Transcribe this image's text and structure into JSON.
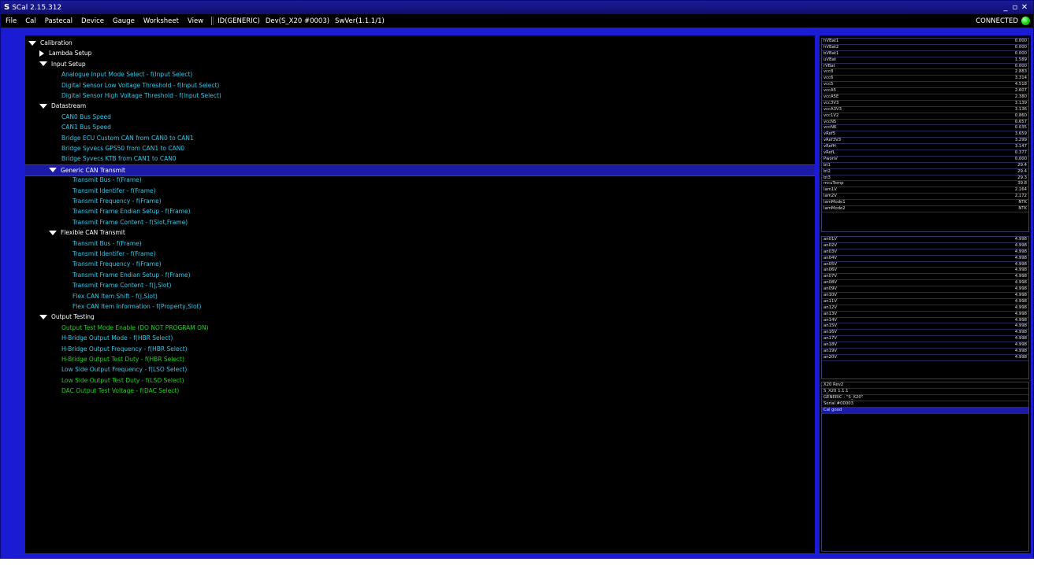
{
  "window": {
    "title": "SCal 2.15.312"
  },
  "menu": {
    "items": [
      "File",
      "Cal",
      "Pastecal",
      "Device",
      "Gauge",
      "Worksheet",
      "View"
    ],
    "info": [
      "ID(GENERIC)",
      "Dev(S_X20 #0003)",
      "SwVer(1.1.1/1)"
    ],
    "status": "CONNECTED",
    "status_color": "#1ee01e"
  },
  "tree": [
    {
      "label": "Calibration",
      "indent": 0,
      "arrow": "down",
      "color": "white"
    },
    {
      "label": "Lambda Setup",
      "indent": 1,
      "arrow": "right",
      "color": "white"
    },
    {
      "label": "Input Setup",
      "indent": 1,
      "arrow": "down",
      "color": "white"
    },
    {
      "label": "Analogue Input Mode Select  - f(Input Select)",
      "indent": 2,
      "arrow": "",
      "color": "cyan"
    },
    {
      "label": "Digital Sensor Low Voltage Threshold  - f(Input Select)",
      "indent": 2,
      "arrow": "",
      "color": "cyan"
    },
    {
      "label": "Digital Sensor High Voltage Threshold  - f(Input Select)",
      "indent": 2,
      "arrow": "",
      "color": "cyan"
    },
    {
      "label": "Datastream",
      "indent": 1,
      "arrow": "down",
      "color": "white"
    },
    {
      "label": "CAN0 Bus Speed",
      "indent": 2,
      "arrow": "",
      "color": "cyan"
    },
    {
      "label": "CAN1 Bus Speed",
      "indent": 2,
      "arrow": "",
      "color": "cyan"
    },
    {
      "label": "Bridge ECU Custom CAN from CAN0 to CAN1",
      "indent": 2,
      "arrow": "",
      "color": "cyan"
    },
    {
      "label": "Bridge Syvecs GPS50 from CAN1 to CAN0",
      "indent": 2,
      "arrow": "",
      "color": "cyan"
    },
    {
      "label": "Bridge Syvecs KTB from CAN1 to CAN0",
      "indent": 2,
      "arrow": "",
      "color": "cyan"
    },
    {
      "label": "Generic CAN Transmit",
      "indent": 2,
      "arrow": "down",
      "color": "white",
      "selected": true
    },
    {
      "label": "Transmit Bus - f(Frame)",
      "indent": 3,
      "arrow": "",
      "color": "cyan"
    },
    {
      "label": "Transmit Identifer - f(Frame)",
      "indent": 3,
      "arrow": "",
      "color": "cyan"
    },
    {
      "label": "Transmit Frequency - f(Frame)",
      "indent": 3,
      "arrow": "",
      "color": "cyan"
    },
    {
      "label": "Transmit Frame Endian Setup - f(Frame)",
      "indent": 3,
      "arrow": "",
      "color": "cyan"
    },
    {
      "label": "Transmit Frame Content - f(Slot,Frame)",
      "indent": 3,
      "arrow": "",
      "color": "cyan"
    },
    {
      "label": "Flexible CAN Transmit",
      "indent": 2,
      "arrow": "down",
      "color": "white"
    },
    {
      "label": "Transmit Bus - f(Frame)",
      "indent": 3,
      "arrow": "",
      "color": "cyan"
    },
    {
      "label": "Transmit Identifer - f(Frame)",
      "indent": 3,
      "arrow": "",
      "color": "cyan"
    },
    {
      "label": "Transmit Frequency - f(Frame)",
      "indent": 3,
      "arrow": "",
      "color": "cyan"
    },
    {
      "label": "Transmit Frame Endian Setup - f(Frame)",
      "indent": 3,
      "arrow": "",
      "color": "cyan"
    },
    {
      "label": "Transmit Frame Content - f(|,Slot)",
      "indent": 3,
      "arrow": "",
      "color": "cyan"
    },
    {
      "label": "Flex CAN Item Shift - f(|,Slot)",
      "indent": 3,
      "arrow": "",
      "color": "cyan"
    },
    {
      "label": "Flex CAN Item Information - f(Property,Slot)",
      "indent": 3,
      "arrow": "",
      "color": "cyan"
    },
    {
      "label": "Output Testing",
      "indent": 1,
      "arrow": "down",
      "color": "white"
    },
    {
      "label": "Output Test Mode Enable (DO NOT PROGRAM ON)",
      "indent": 2,
      "arrow": "",
      "color": "green"
    },
    {
      "label": "H-Bridge Output Mode - f(HBR Select)",
      "indent": 2,
      "arrow": "",
      "color": "cyan"
    },
    {
      "label": "H-Bridge Output Frequency - f(HBR Select)",
      "indent": 2,
      "arrow": "",
      "color": "cyan"
    },
    {
      "label": "H-Bridge Output Test Duty - f(HBR Select)",
      "indent": 2,
      "arrow": "",
      "color": "green"
    },
    {
      "label": "Low Side Output Frequency - f(LSO Select)",
      "indent": 2,
      "arrow": "",
      "color": "cyan"
    },
    {
      "label": "Low Side Output Test Duty - f(LSO Select)",
      "indent": 2,
      "arrow": "",
      "color": "green"
    },
    {
      "label": "DAC Output Test Voltage - f(DAC Select)",
      "indent": 2,
      "arrow": "",
      "color": "green"
    }
  ],
  "gauges1": [
    {
      "name": "hVBat1",
      "value": "0.000"
    },
    {
      "name": "hVBat2",
      "value": "0.000"
    },
    {
      "name": "bVBat1",
      "value": "0.000"
    },
    {
      "name": "uVBat",
      "value": "1.589"
    },
    {
      "name": "rVBat",
      "value": "0.000"
    },
    {
      "name": "vcc8",
      "value": "2.883"
    },
    {
      "name": "vcc6",
      "value": "3.314"
    },
    {
      "name": "vcc5",
      "value": "4.518"
    },
    {
      "name": "vccA5",
      "value": "2.607"
    },
    {
      "name": "vccA5E",
      "value": "2.380"
    },
    {
      "name": "vcc3V3",
      "value": "3.139"
    },
    {
      "name": "vccA3V3",
      "value": "3.136"
    },
    {
      "name": "vcc1V2",
      "value": "0.860"
    },
    {
      "name": "vccN5",
      "value": "0.657"
    },
    {
      "name": "vccN6",
      "value": "0.035"
    },
    {
      "name": "vRef5",
      "value": "3.659"
    },
    {
      "name": "vRef3V3",
      "value": "3.299"
    },
    {
      "name": "vRefH",
      "value": "3.147"
    },
    {
      "name": "vRefL",
      "value": "0.377"
    },
    {
      "name": "PwonV",
      "value": "0.000"
    },
    {
      "name": "bt1",
      "value": "29.4"
    },
    {
      "name": "bt2",
      "value": "29.4"
    },
    {
      "name": "bt3",
      "value": "29.3"
    },
    {
      "name": "mcuTemp",
      "value": "39.8"
    },
    {
      "name": "lam1V",
      "value": "2.164"
    },
    {
      "name": "lam2V",
      "value": "2.172"
    },
    {
      "name": "lamMode1",
      "value": "NTK"
    },
    {
      "name": "lamMode2",
      "value": "NTK"
    }
  ],
  "gauges2": [
    {
      "name": "an01V",
      "value": "4.998"
    },
    {
      "name": "an02V",
      "value": "4.998"
    },
    {
      "name": "an03V",
      "value": "4.998"
    },
    {
      "name": "an04V",
      "value": "4.998"
    },
    {
      "name": "an05V",
      "value": "4.998"
    },
    {
      "name": "an06V",
      "value": "4.998"
    },
    {
      "name": "an07V",
      "value": "4.998"
    },
    {
      "name": "an08V",
      "value": "4.998"
    },
    {
      "name": "an09V",
      "value": "4.998"
    },
    {
      "name": "an10V",
      "value": "4.998"
    },
    {
      "name": "an11V",
      "value": "4.998"
    },
    {
      "name": "an12V",
      "value": "4.998"
    },
    {
      "name": "an13V",
      "value": "4.998"
    },
    {
      "name": "an14V",
      "value": "4.998"
    },
    {
      "name": "an15V",
      "value": "4.998"
    },
    {
      "name": "an16V",
      "value": "4.998"
    },
    {
      "name": "an17V",
      "value": "4.998"
    },
    {
      "name": "an18V",
      "value": "4.998"
    },
    {
      "name": "an19V",
      "value": "4.998"
    },
    {
      "name": "an20V",
      "value": "4.998"
    }
  ],
  "device_info": [
    {
      "text": "X20 Rev2"
    },
    {
      "text": "S_X20 1.1.1"
    },
    {
      "text": "GENERIC - \"S_X20\""
    },
    {
      "text": "Serial #00003"
    },
    {
      "text": "Cal good",
      "selected": true
    }
  ]
}
